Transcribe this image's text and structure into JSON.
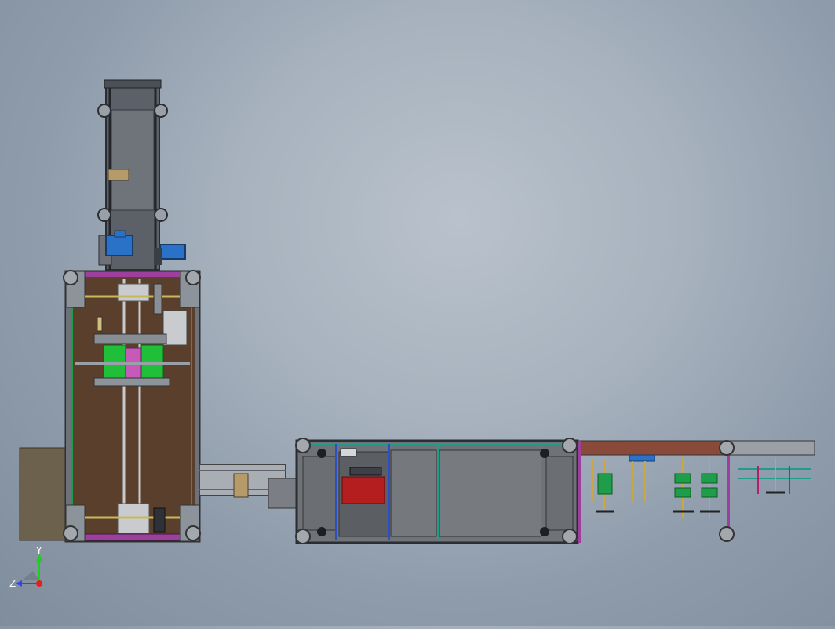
{
  "viewport": {
    "background_top": "#b9c2cc",
    "background_bottom": "#7f8d9d"
  },
  "triad": {
    "x_label": "",
    "y_label": "Y",
    "z_label": "Z",
    "colors": {
      "y": "#22cc22",
      "z": "#3344ff",
      "origin": "#dd2222"
    }
  },
  "model": {
    "frame_color": "#555d66",
    "plate_color": "#5a3f2c",
    "accent_colors": [
      "#1e9e4a",
      "#b41e1e",
      "#2a72c7",
      "#9e3f9e",
      "#caa740"
    ]
  }
}
